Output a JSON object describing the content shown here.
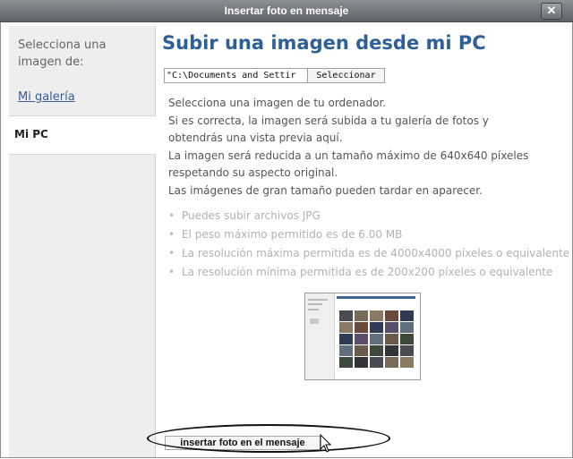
{
  "window": {
    "title": "Insertar foto en mensaje"
  },
  "sidebar": {
    "prompt": "Selecciona una imagen de:",
    "gallery_link": "Mi galería",
    "active_item": "Mi PC"
  },
  "main": {
    "heading": "Subir una imagen desde mi PC",
    "file_input_value": "\"C:\\Documents and Settir",
    "select_button": "Seleccionar",
    "description": [
      "Selecciona una imagen de tu ordenador.",
      "Si es correcta, la imagen será subida a tu galería de fotos y",
      "obtendrás una vista previa aquí.",
      "La imagen será reducida a un tamaño máximo de 640x640 píxeles",
      "respetando su aspecto original.",
      "Las imágenes de gran tamaño pueden tardar en aparecer."
    ],
    "rules": [
      "Puedes subir archivos JPG",
      "El peso máximo permitido es de 6.00 MB",
      "La resolución máxima permitida es de 4000x4000 píxeles o equivalente",
      "La resolución mínima permitida es de 200x200 píxeles o equivalente"
    ],
    "insert_button": "insertar foto en el mensaje"
  },
  "icons": {
    "close": "close-icon",
    "cursor": "mouse-pointer-icon",
    "preview": "image-preview-thumbnail"
  },
  "colors": {
    "heading": "#2f5f97",
    "link": "#345f9e",
    "rule_text": "#b2b2b2",
    "titlebar": "#6f7278"
  }
}
